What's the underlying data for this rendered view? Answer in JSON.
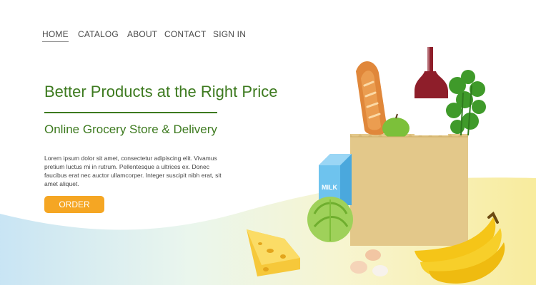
{
  "nav": {
    "items": [
      {
        "label": "HOME",
        "active": true
      },
      {
        "label": "CATALOG"
      },
      {
        "label": "ABOUT"
      },
      {
        "label": "CONTACT"
      },
      {
        "label": "SIGN IN"
      }
    ]
  },
  "hero": {
    "title": "Better Products at the Right Price",
    "subtitle": "Online Grocery Store & Delivery",
    "body": "Lorem ipsum dolor sit amet, consectetur adipiscing elit. Vivamus pretium luctus mi in rutrum. Pellentesque a ultrices ex. Donec faucibus erat nec auctor ullamcorper. Integer suscipit nibh erat, sit amet aliquet.",
    "order_label": "ORDER"
  },
  "illustration": {
    "milk_label": "MILK"
  },
  "colors": {
    "accent_green": "#3d7a1f",
    "button_orange": "#f5a623",
    "bag": "#e3c88a",
    "wine": "#8e1e2a"
  }
}
